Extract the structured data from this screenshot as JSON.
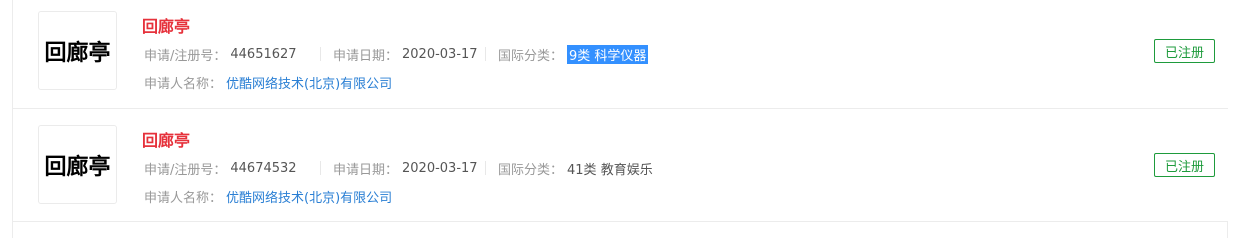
{
  "results": [
    {
      "logo_text": "回廊亭",
      "name": "回廊亭",
      "reg_label": "申请/注册号：",
      "reg_no": "44651627",
      "date_label": "申请日期：",
      "date": "2020-03-17",
      "class_label": "国际分类：",
      "class_value": "9类 科学仪器",
      "applicant_label": "申请人名称：",
      "applicant": "优酷网络技术(北京)有限公司",
      "status": "已注册"
    },
    {
      "logo_text": "回廊亭",
      "name": "回廊亭",
      "reg_label": "申请/注册号：",
      "reg_no": "44674532",
      "date_label": "申请日期：",
      "date": "2020-03-17",
      "class_label": "国际分类：",
      "class_value": "41类 教育娱乐",
      "applicant_label": "申请人名称：",
      "applicant": "优酷网络技术(北京)有限公司",
      "status": "已注册"
    }
  ],
  "colors": {
    "name": "#e6323c",
    "link": "#2a7fd4",
    "status": "#1e9b3c",
    "highlight": "#3390ff"
  }
}
